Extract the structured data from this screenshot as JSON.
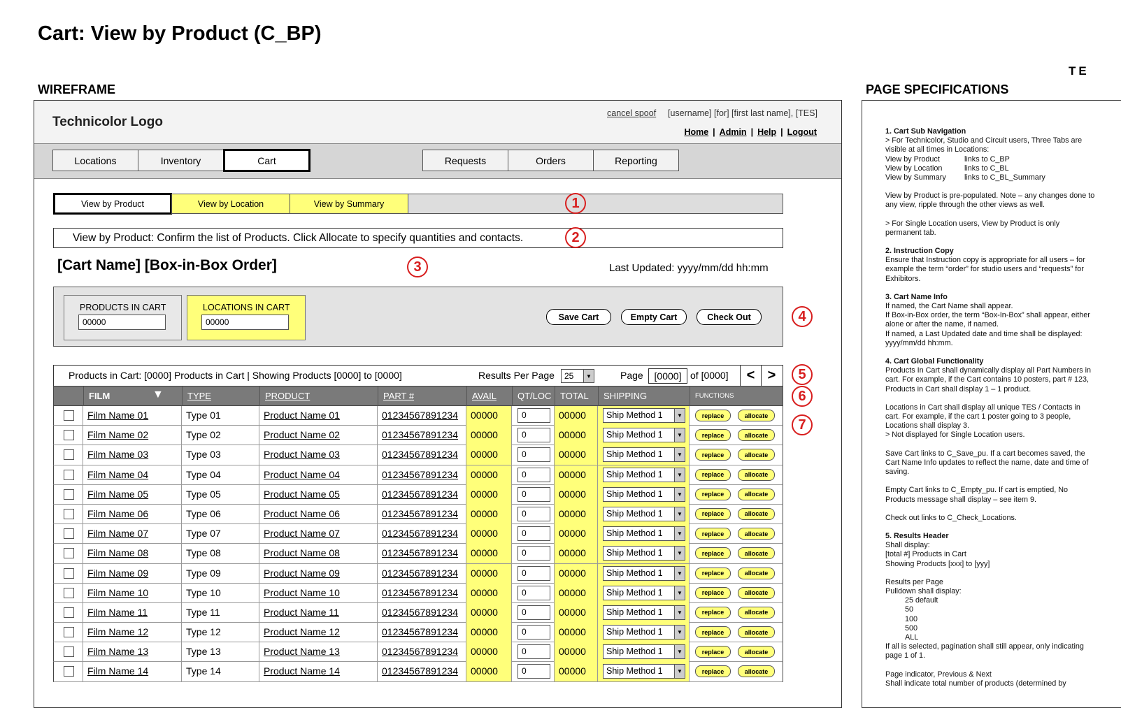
{
  "page_title": "Cart: View by Product (C_BP)",
  "wireframe_label": "WIREFRAME",
  "spec_label": "PAGE SPECIFICATIONS",
  "brand_clip": "TE",
  "header": {
    "logo": "Technicolor Logo",
    "cancel_spoof": "cancel spoof",
    "user_info": "[username]  [for]  [first last name], [TES]",
    "links": [
      "Home",
      "Admin",
      "Help",
      "Logout"
    ]
  },
  "main_tabs": [
    "Locations",
    "Inventory",
    "Cart",
    "Requests",
    "Orders",
    "Reporting"
  ],
  "active_main_tab": "Cart",
  "sub_tabs": [
    "View by Product",
    "View by Location",
    "View by Summary"
  ],
  "callouts": [
    "1",
    "2",
    "3",
    "4",
    "5",
    "6",
    "7"
  ],
  "instruction": "View by Product: Confirm the list of Products.  Click Allocate to specify quantities and contacts.",
  "cart_name": "[Cart Name]  [Box-in-Box Order]",
  "last_updated": "Last Updated: yyyy/mm/dd  hh:mm",
  "global": {
    "products_label": "PRODUCTS IN CART",
    "products_value": "00000",
    "locations_label": "LOCATIONS IN CART",
    "locations_value": "00000",
    "buttons": [
      "Save Cart",
      "Empty Cart",
      "Check Out"
    ]
  },
  "results": {
    "summary": "Products in Cart: [0000] Products in Cart |  Showing Products [0000] to [0000]",
    "rpp_label": "Results Per Page",
    "rpp_value": "25",
    "page_label": "Page",
    "page_value": "[0000]",
    "of_label": "of [0000]",
    "prev": "<",
    "next": ">"
  },
  "table": {
    "headers": [
      "FILM",
      "TYPE",
      "PRODUCT",
      "PART #",
      "AVAIL",
      "QT/LOC",
      "TOTAL",
      "SHIPPING",
      "FUNCTIONS"
    ],
    "sort_indicator": "▼",
    "rows": [
      {
        "film": "Film Name 01",
        "type": "Type 01",
        "product": "Product Name 01",
        "part": "01234567891234",
        "avail": "00000",
        "qty": "0",
        "total": "00000",
        "ship": "Ship Method 1"
      },
      {
        "film": "Film Name 02",
        "type": "Type 02",
        "product": "Product Name 02",
        "part": "01234567891234",
        "avail": "00000",
        "qty": "0",
        "total": "00000",
        "ship": "Ship Method 1"
      },
      {
        "film": "Film Name 03",
        "type": "Type 03",
        "product": "Product Name 03",
        "part": "01234567891234",
        "avail": "00000",
        "qty": "0",
        "total": "00000",
        "ship": "Ship Method 1"
      },
      {
        "film": "Film Name 04",
        "type": "Type 04",
        "product": "Product Name 04",
        "part": "01234567891234",
        "avail": "00000",
        "qty": "0",
        "total": "00000",
        "ship": "Ship Method 1"
      },
      {
        "film": "Film Name 05",
        "type": "Type 05",
        "product": "Product Name 05",
        "part": "01234567891234",
        "avail": "00000",
        "qty": "0",
        "total": "00000",
        "ship": "Ship Method 1"
      },
      {
        "film": "Film Name 06",
        "type": "Type 06",
        "product": "Product Name 06",
        "part": "01234567891234",
        "avail": "00000",
        "qty": "0",
        "total": "00000",
        "ship": "Ship Method 1"
      },
      {
        "film": "Film Name 07",
        "type": "Type 07",
        "product": "Product Name 07",
        "part": "01234567891234",
        "avail": "00000",
        "qty": "0",
        "total": "00000",
        "ship": "Ship Method 1"
      },
      {
        "film": "Film Name 08",
        "type": "Type 08",
        "product": "Product Name 08",
        "part": "01234567891234",
        "avail": "00000",
        "qty": "0",
        "total": "00000",
        "ship": "Ship Method 1"
      },
      {
        "film": "Film Name 09",
        "type": "Type 09",
        "product": "Product Name 09",
        "part": "01234567891234",
        "avail": "00000",
        "qty": "0",
        "total": "00000",
        "ship": "Ship Method 1"
      },
      {
        "film": "Film Name 10",
        "type": "Type 10",
        "product": "Product Name 10",
        "part": "01234567891234",
        "avail": "00000",
        "qty": "0",
        "total": "00000",
        "ship": "Ship Method 1"
      },
      {
        "film": "Film Name 11",
        "type": "Type 11",
        "product": "Product Name 11",
        "part": "01234567891234",
        "avail": "00000",
        "qty": "0",
        "total": "00000",
        "ship": "Ship Method 1"
      },
      {
        "film": "Film Name 12",
        "type": "Type 12",
        "product": "Product Name 12",
        "part": "01234567891234",
        "avail": "00000",
        "qty": "0",
        "total": "00000",
        "ship": "Ship Method 1"
      },
      {
        "film": "Film Name 13",
        "type": "Type 13",
        "product": "Product Name 13",
        "part": "01234567891234",
        "avail": "00000",
        "qty": "0",
        "total": "00000",
        "ship": "Ship Method 1"
      },
      {
        "film": "Film Name 14",
        "type": "Type 14",
        "product": "Product Name 14",
        "part": "01234567891234",
        "avail": "00000",
        "qty": "0",
        "total": "00000",
        "ship": "Ship Method 1"
      }
    ],
    "replace_label": "replace",
    "allocate_label": "allocate"
  },
  "colors": {
    "highlight": "#ffff7a",
    "callout": "#d81e1e",
    "header_gray": "#7a7a7a"
  },
  "spec_paragraphs": [
    {
      "kind": "h",
      "text": "1.  Cart Sub Navigation"
    },
    {
      "kind": "t",
      "text": "> For Technicolor, Studio and Circuit users, Three Tabs are visible at all times in Locations:"
    },
    {
      "kind": "pair",
      "a": "View by Product",
      "b": "links to C_BP"
    },
    {
      "kind": "pair",
      "a": "View by Location",
      "b": "links to C_BL"
    },
    {
      "kind": "pairp",
      "a": "View by Summary",
      "b": "links to C_BL_Summary"
    },
    {
      "kind": "p",
      "text": "View by Product is pre-populated.  Note – any changes done to any view, ripple through the other views as well."
    },
    {
      "kind": "p",
      "text": "> For Single Location users, View by Product is only permanent tab."
    },
    {
      "kind": "h",
      "text": "2.  Instruction Copy"
    },
    {
      "kind": "p",
      "text": "Ensure that Instruction copy is appropriate for all users – for example the term “order” for studio users and “requests” for Exhibitors."
    },
    {
      "kind": "h",
      "text": "3.  Cart Name Info"
    },
    {
      "kind": "t",
      "text": "If named, the Cart Name shall appear."
    },
    {
      "kind": "t",
      "text": "If Box-in-Box order, the term “Box-In-Box” shall appear, either alone or after the name, if named."
    },
    {
      "kind": "t",
      "text": "If named, a Last Updated date and time shall be displayed:"
    },
    {
      "kind": "p",
      "text": "yyyy/mm/dd  hh:mm."
    },
    {
      "kind": "h",
      "text": "4.  Cart Global Functionality"
    },
    {
      "kind": "p",
      "text": "Products In Cart shall dynamically display all Part Numbers in cart.  For example, if the Cart contains 10 posters, part # 123, Products in Cart shall display 1 – 1 product."
    },
    {
      "kind": "t",
      "text": "Locations in Cart shall display all unique TES / Contacts in cart.  For example, if the cart 1 poster going to 3 people, Locations shall display 3."
    },
    {
      "kind": "p",
      "text": "> Not displayed for Single Location users."
    },
    {
      "kind": "p",
      "text": "Save Cart links to C_Save_pu.  If a cart becomes saved, the Cart Name Info updates to reflect the name, date and time of saving."
    },
    {
      "kind": "p",
      "text": "Empty Cart links to C_Empty_pu.  If cart is emptied, No Products message shall display – see item 9."
    },
    {
      "kind": "p",
      "text": "Check out links to C_Check_Locations."
    },
    {
      "kind": "h",
      "text": "5.  Results Header"
    },
    {
      "kind": "t",
      "text": "Shall display:"
    },
    {
      "kind": "t",
      "text": "[total #] Products in Cart"
    },
    {
      "kind": "p",
      "text": "Showing Products [xxx] to [yyy]"
    },
    {
      "kind": "t",
      "text": "Results per Page"
    },
    {
      "kind": "t",
      "text": "Pulldown shall display:"
    },
    {
      "kind": "i",
      "text": "25  default"
    },
    {
      "kind": "i",
      "text": "50"
    },
    {
      "kind": "i",
      "text": "100"
    },
    {
      "kind": "i",
      "text": "500"
    },
    {
      "kind": "i",
      "text": "ALL"
    },
    {
      "kind": "p",
      "text": "If all is selected, pagination shall still appear, only indicating page 1 of 1."
    },
    {
      "kind": "t",
      "text": "Page indicator, Previous & Next"
    },
    {
      "kind": "t",
      "text": "Shall indicate total number of products (determined by"
    }
  ]
}
